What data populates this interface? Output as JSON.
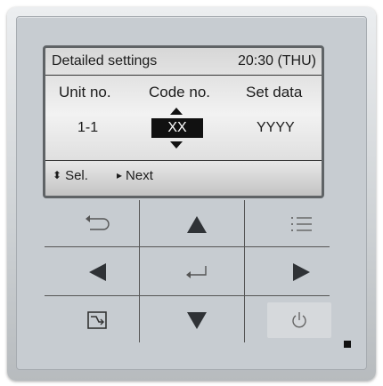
{
  "screen": {
    "title": "Detailed settings",
    "clock": "20:30 (THU)",
    "columns": [
      "Unit no.",
      "Code no.",
      "Set data"
    ],
    "values": {
      "unit_no": "1-1",
      "code_no": "XX",
      "set_data": "YYYY"
    },
    "footer": {
      "select_label": "Sel.",
      "next_label": "Next"
    }
  },
  "keys": {
    "back": "back-icon",
    "up": "arrow-up-icon",
    "menu": "menu-icon",
    "left": "arrow-left-icon",
    "enter": "enter-icon",
    "right": "arrow-right-icon",
    "mode": "mode-icon",
    "down": "arrow-down-icon",
    "power": "power-icon"
  },
  "colors": {
    "lcd_bg": "#eeeeee",
    "panel": "#c7ccd1",
    "highlight": "#111111"
  }
}
